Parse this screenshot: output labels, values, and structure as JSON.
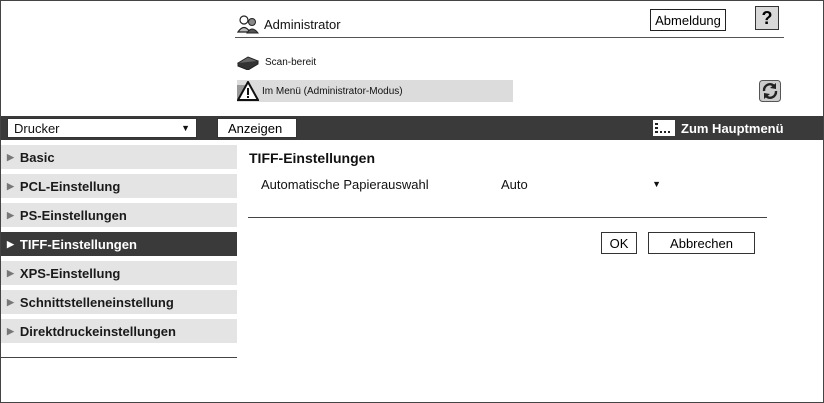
{
  "header": {
    "user_label": "Administrator",
    "logout_label": "Abmeldung",
    "help_label": "?"
  },
  "status": {
    "scan_text": "Scan-bereit",
    "menu_text": "Im Menü (Administrator-Modus)"
  },
  "toolbar": {
    "category_value": "Drucker",
    "show_label": "Anzeigen",
    "main_menu_label": "Zum Hauptmenü"
  },
  "sidebar": {
    "items": [
      {
        "label": "Basic"
      },
      {
        "label": "PCL-Einstellung"
      },
      {
        "label": "PS-Einstellungen"
      },
      {
        "label": "TIFF-Einstellungen"
      },
      {
        "label": "XPS-Einstellung"
      },
      {
        "label": "Schnittstelleneinstellung"
      },
      {
        "label": "Direktdruckeinstellungen"
      }
    ],
    "active_index": 3
  },
  "content": {
    "title": "TIFF-Einstellungen",
    "field_label": "Automatische Papierauswahl",
    "field_value": "Auto",
    "ok_label": "OK",
    "cancel_label": "Abbrechen"
  },
  "icons": {
    "admin": "admin-users-icon",
    "scanner": "scanner-icon",
    "warning": "warning-icon",
    "refresh": "refresh-icon",
    "menu": "menu-list-icon",
    "dropdown": "chevron-down-icon",
    "nav_arrow": "triangle-right-icon"
  },
  "colors": {
    "bar": "#3a3a3a",
    "sidebar_item": "#e4e4e4",
    "status_bg": "#dcdcdc"
  }
}
